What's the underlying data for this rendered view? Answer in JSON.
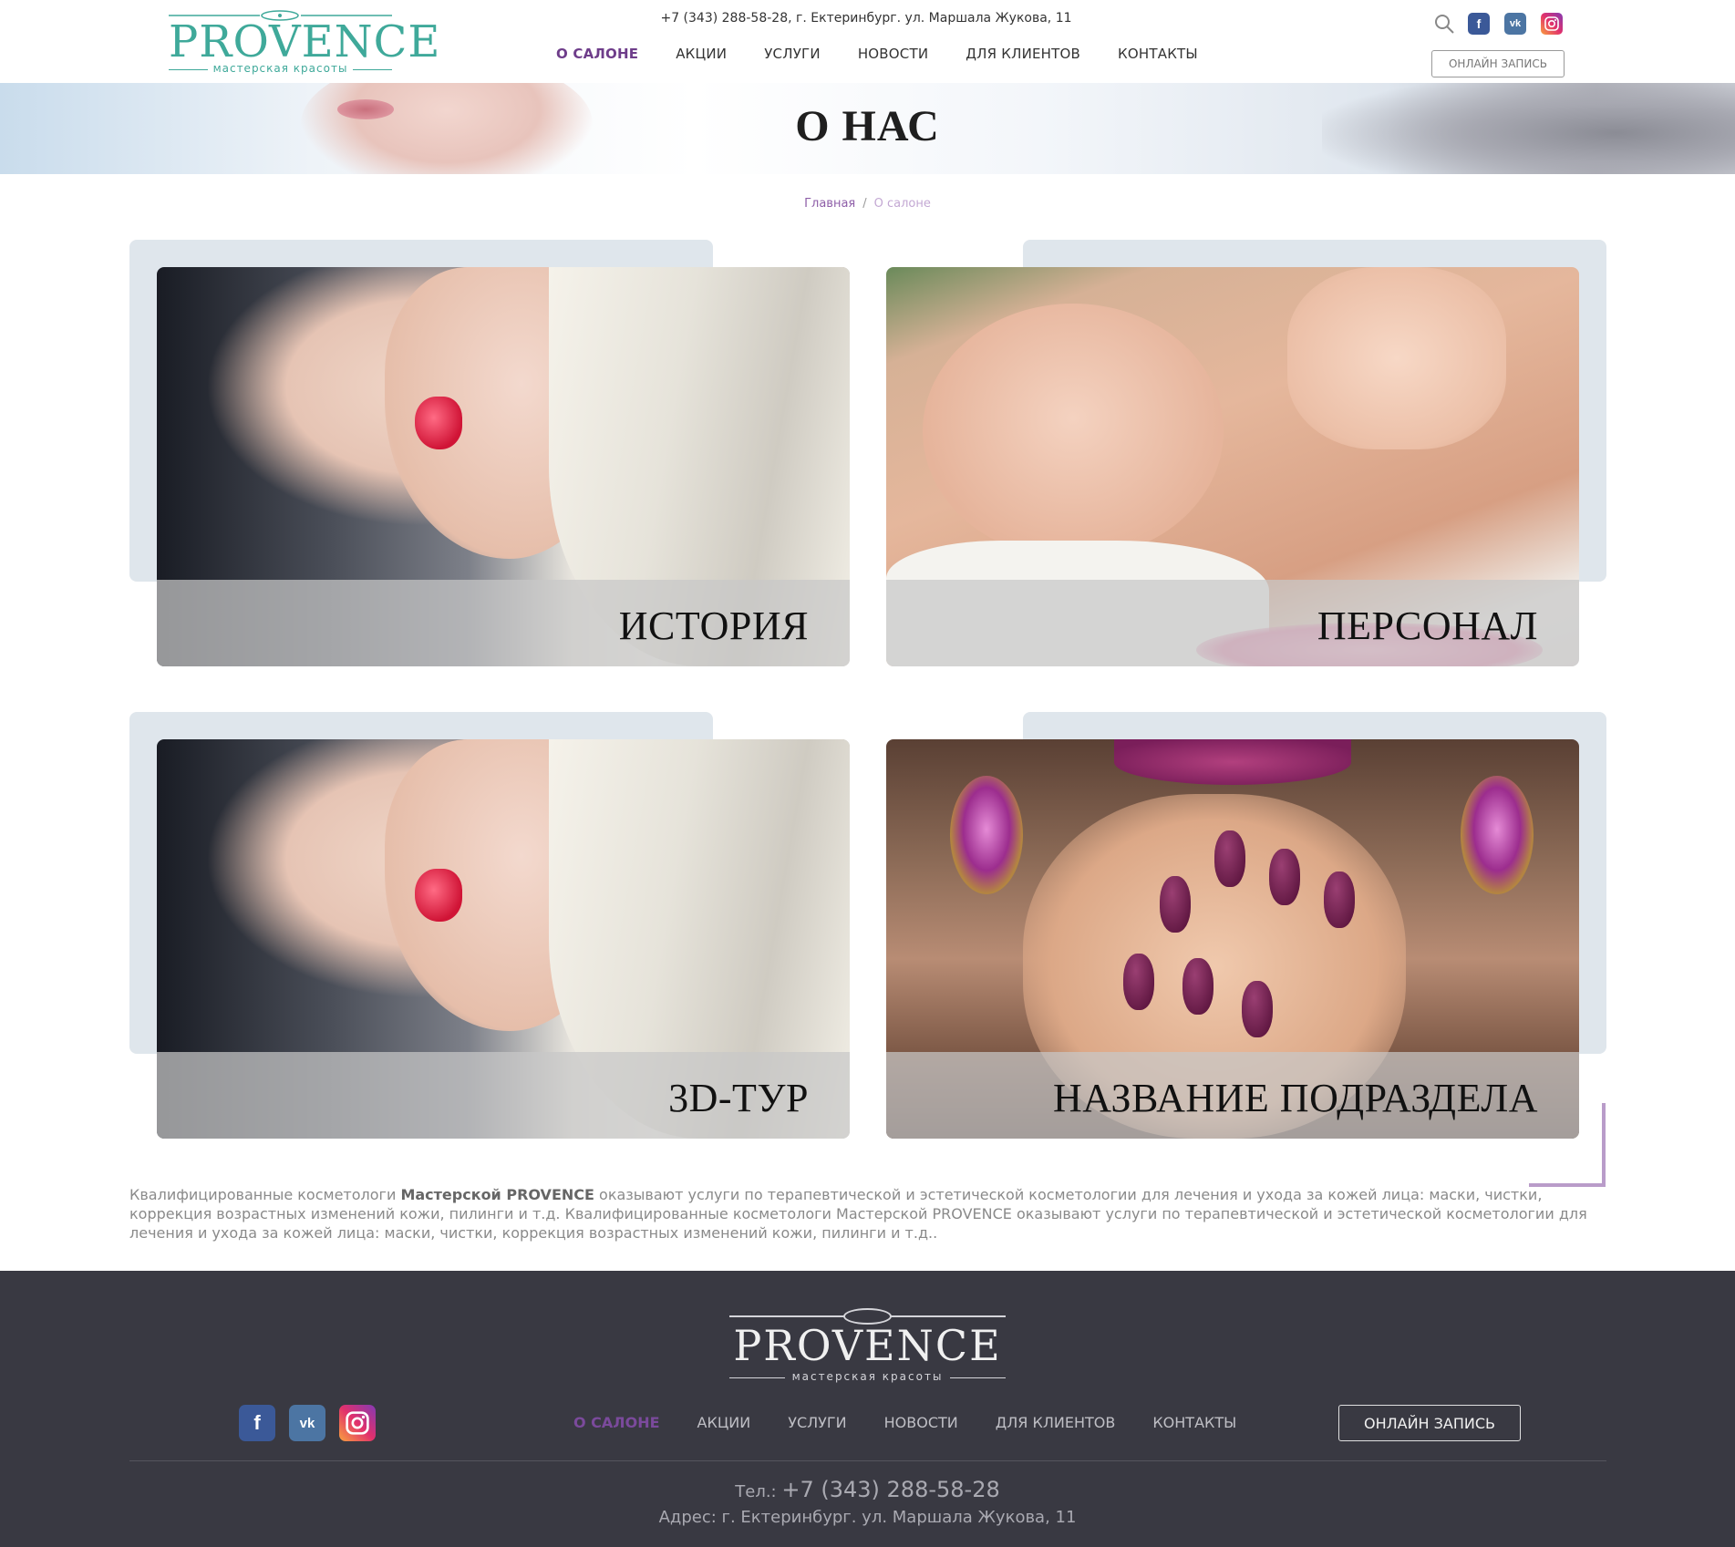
{
  "header": {
    "logo_text": "PROVENCE",
    "logo_subtitle": "мастерская красоты",
    "contact_line": "+7 (343) 288-58-28, г. Ектеринбург. ул. Маршала Жукова, 11",
    "nav": [
      {
        "label": "О САЛОНЕ",
        "active": true
      },
      {
        "label": "АКЦИИ"
      },
      {
        "label": "УСЛУГИ"
      },
      {
        "label": "НОВОСТИ"
      },
      {
        "label": "ДЛЯ КЛИЕНТОВ"
      },
      {
        "label": "КОНТАКТЫ"
      }
    ],
    "icons": [
      "search-icon",
      "facebook-icon",
      "vk-icon",
      "instagram-icon"
    ],
    "online_button": "ОНЛАЙН ЗАПИСЬ"
  },
  "hero": {
    "title": "О НАС"
  },
  "breadcrumb": {
    "home": "Главная",
    "separator": "/",
    "current": "О салоне"
  },
  "cards": [
    {
      "label": "ИСТОРИЯ"
    },
    {
      "label": "ПЕРСОНАЛ"
    },
    {
      "label": "3D-ТУР"
    },
    {
      "label": "НАЗВАНИЕ ПОДРАЗДЕЛА"
    }
  ],
  "about": {
    "part1": "Квалифицированные косметологи ",
    "bold": "Мастерской PROVENCE",
    "part2": " оказывают услуги по терапевтической и эстетической косметологии для лечения и ухода за кожей лица: маски, чистки, коррекция возрастных изменений кожи, пилинги и т.д. Квалифицированные косметологи Мастерской PROVENCE оказывают услуги по терапевтической и эстетической косметологии для лечения и ухода за кожей лица: маски, чистки, коррекция возрастных изменений кожи, пилинги и т.д.."
  },
  "footer": {
    "logo_text": "PROVENCE",
    "logo_subtitle": "мастерская красоты",
    "nav": [
      {
        "label": "О САЛОНЕ",
        "active": true
      },
      {
        "label": "АКЦИИ"
      },
      {
        "label": "УСЛУГИ"
      },
      {
        "label": "НОВОСТИ"
      },
      {
        "label": "ДЛЯ КЛИЕНТОВ"
      },
      {
        "label": "КОНТАКТЫ"
      }
    ],
    "online_button": "ОНЛАЙН ЗАПИСЬ",
    "phone_label": "Тел.:",
    "phone": "+7 (343) 288-58-28",
    "address": "Адрес: г. Ектеринбург. ул. Маршала Жукова, 11"
  },
  "colors": {
    "brand_teal": "#3fa99a",
    "accent_purple": "#6e3d8a",
    "footer_bg": "#393942",
    "card_bg": "#dfe6ec"
  }
}
